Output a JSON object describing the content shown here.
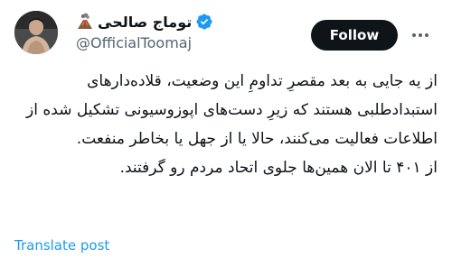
{
  "author": {
    "display_name": "توماج صالحی",
    "handle": "@OfficialToomaj",
    "emoji_icon": "volcano-icon",
    "verified_icon": "verified-badge-icon",
    "verified_color": "#1d9bf0"
  },
  "actions": {
    "follow_label": "Follow",
    "more_icon": "more-horizontal-icon"
  },
  "tweet": {
    "paragraph_1": "از یه جایی به بعد مقصرِ تداومِ این وضعیت، قلاده‌دارهای استبدادطلبی هستند که زیرِ دست‌های اپوزوسیونی تشکیل شده از اطلاعات فعالیت می‌کنند، حالا یا از جهل یا بخاطر منفعت.",
    "paragraph_2": "از ۴۰۱ تا الان همین‌ها جلوی اتحاد مردم رو گرفتند."
  },
  "footer": {
    "translate_label": "Translate post"
  }
}
